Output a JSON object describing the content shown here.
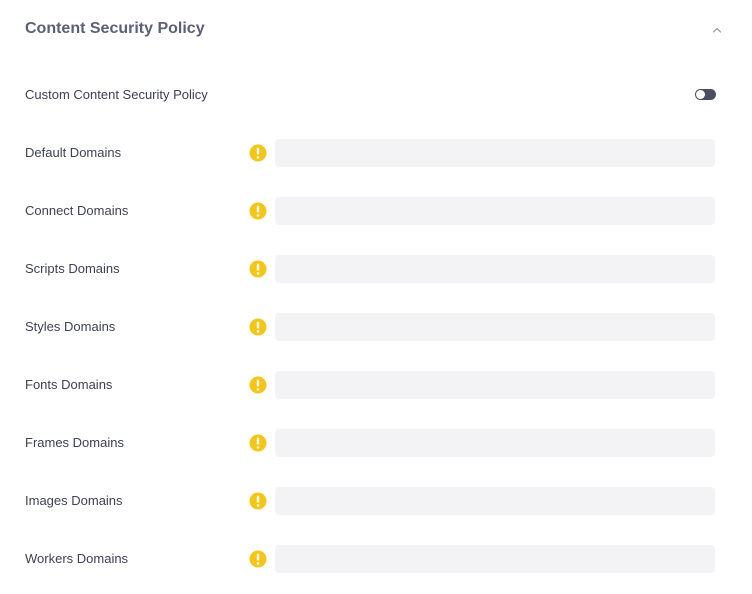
{
  "section": {
    "title": "Content Security Policy",
    "expanded": true
  },
  "custom_csp": {
    "label": "Custom Content Security Policy",
    "enabled": false
  },
  "colors": {
    "warning": "#f5c518",
    "toggle_track": "#4a4d60",
    "field_bg": "#f3f3f6"
  },
  "fields": [
    {
      "label": "Default Domains",
      "value": "",
      "icon": "warning-icon"
    },
    {
      "label": "Connect Domains",
      "value": "",
      "icon": "warning-icon"
    },
    {
      "label": "Scripts Domains",
      "value": "",
      "icon": "warning-icon"
    },
    {
      "label": "Styles Domains",
      "value": "",
      "icon": "warning-icon"
    },
    {
      "label": "Fonts Domains",
      "value": "",
      "icon": "warning-icon"
    },
    {
      "label": "Frames Domains",
      "value": "",
      "icon": "warning-icon"
    },
    {
      "label": "Images Domains",
      "value": "",
      "icon": "warning-icon"
    },
    {
      "label": "Workers Domains",
      "value": "",
      "icon": "warning-icon"
    }
  ]
}
